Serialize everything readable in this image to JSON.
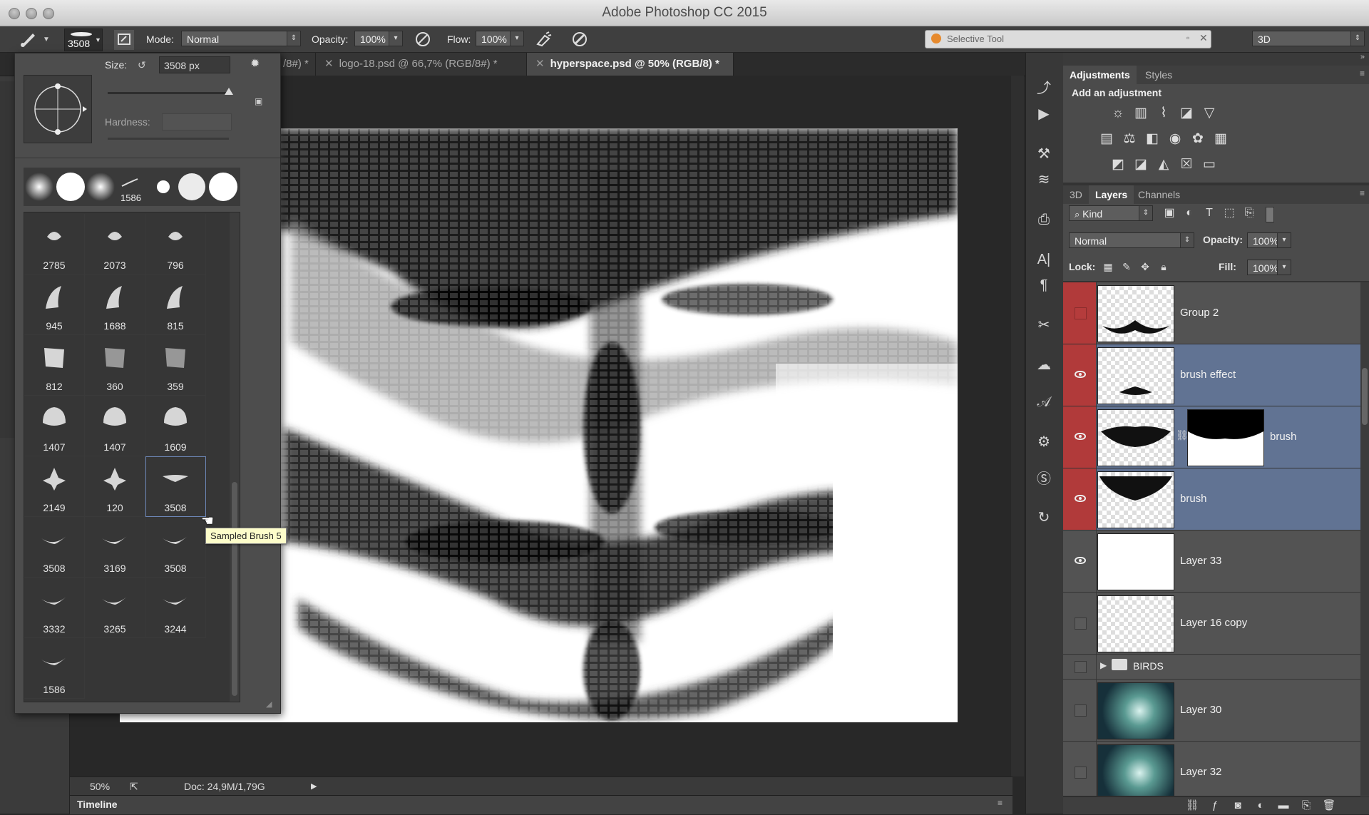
{
  "app": {
    "title": "Adobe Photoshop CC 2015"
  },
  "options": {
    "brush_size_badge": "3508",
    "mode_label": "Mode:",
    "mode_value": "Normal",
    "opacity_label": "Opacity:",
    "opacity_value": "100%",
    "flow_label": "Flow:",
    "flow_value": "100%",
    "plugin_label": "Selective Tool",
    "workspace_value": "3D"
  },
  "tabs": [
    {
      "label": "/8#) *"
    },
    {
      "label": "logo-18.psd @ 66,7% (RGB/8#) *"
    },
    {
      "label": "hyperspace.psd @ 50% (RGB/8) *"
    }
  ],
  "brush_picker": {
    "size_label": "Size:",
    "size_value": "3508 px",
    "hardness_label": "Hardness:",
    "recent_label": "1586",
    "tooltip": "Sampled Brush 5",
    "brushes": [
      "2785",
      "2073",
      "796",
      "945",
      "1688",
      "815",
      "812",
      "360",
      "359",
      "1407",
      "1407",
      "1609",
      "2149",
      "120",
      "3508",
      "3508",
      "3169",
      "3508",
      "3332",
      "3265",
      "3244",
      "1586"
    ]
  },
  "status": {
    "zoom": "50%",
    "doc": "Doc: 24,9M/1,79G",
    "timeline": "Timeline"
  },
  "adjustments": {
    "tab_active": "Adjustments",
    "tab_other": "Styles",
    "heading": "Add an adjustment"
  },
  "layers_panel": {
    "tabs": [
      "3D",
      "Layers",
      "Channels"
    ],
    "filter_value": "Kind",
    "blend_value": "Normal",
    "opacity_label": "Opacity:",
    "opacity_value": "100%",
    "lock_label": "Lock:",
    "fill_label": "Fill:",
    "fill_value": "100%",
    "layers": [
      {
        "name": "Group 2",
        "visible": false
      },
      {
        "name": "brush effect",
        "visible": true
      },
      {
        "name": "brush",
        "visible": true
      },
      {
        "name": "brush",
        "visible": true
      },
      {
        "name": "Layer 33",
        "visible": true
      },
      {
        "name": "Layer 16 copy",
        "visible": false
      },
      {
        "name": "BIRDS",
        "visible": false
      },
      {
        "name": "Layer 30",
        "visible": false
      },
      {
        "name": "Layer 32",
        "visible": false
      }
    ]
  }
}
